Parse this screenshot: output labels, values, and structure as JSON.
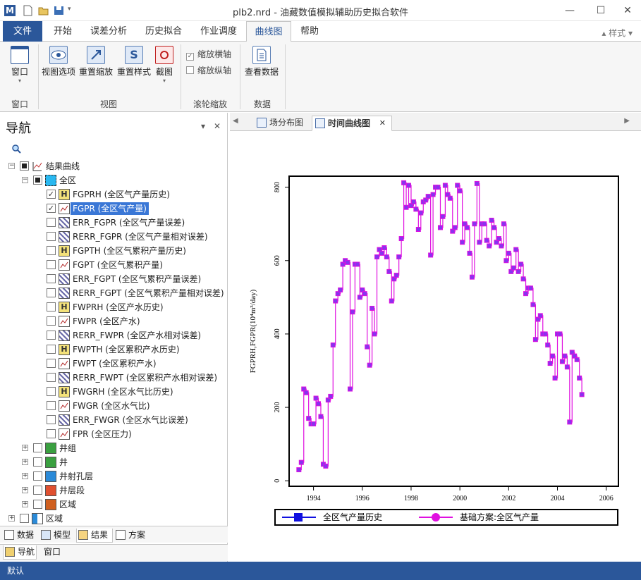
{
  "window": {
    "title": "plb2.nrd - 油藏数值模拟辅助历史拟合软件",
    "minimize": "—",
    "maximize": "☐",
    "close": "✕"
  },
  "tabs": [
    "文件",
    "开始",
    "误差分析",
    "历史拟合",
    "作业调度",
    "曲线图",
    "帮助"
  ],
  "style_menu": "▴ 样式 ▾",
  "ribbon": {
    "window_btn": "窗口",
    "view_options": "视图选项",
    "reset_zoom": "重置缩放",
    "reset_style": "重置样式",
    "screenshot": "截图",
    "zoom_x": "缩放横轴",
    "zoom_y": "缩放纵轴",
    "view_data": "查看数据",
    "group_window": "窗口",
    "group_view": "视图",
    "group_wheel": "滚轮缩放",
    "group_data": "数据"
  },
  "nav": {
    "title": "导航",
    "pin": "▾",
    "close": "✕",
    "tree": {
      "root": "结果曲线",
      "region_all": "全区",
      "items": [
        {
          "label": "FGPRH (全区气产量历史)",
          "checked": "✓"
        },
        {
          "label": "FGPR (全区气产量)",
          "checked": "✓"
        },
        {
          "label": "ERR_FGPR (全区气产量误差)",
          "checked": ""
        },
        {
          "label": "RERR_FGPR (全区气产量相对误差)",
          "checked": ""
        },
        {
          "label": "FGPTH (全区气累积产量历史)",
          "checked": ""
        },
        {
          "label": "FGPT (全区气累积产量)",
          "checked": ""
        },
        {
          "label": "ERR_FGPT (全区气累积产量误差)",
          "checked": ""
        },
        {
          "label": "RERR_FGPT (全区气累积产量相对误差)",
          "checked": ""
        },
        {
          "label": "FWPRH (全区产水历史)",
          "checked": ""
        },
        {
          "label": "FWPR (全区产水)",
          "checked": ""
        },
        {
          "label": "RERR_FWPR (全区产水相对误差)",
          "checked": ""
        },
        {
          "label": "FWPTH (全区累积产水历史)",
          "checked": ""
        },
        {
          "label": "FWPT (全区累积产水)",
          "checked": ""
        },
        {
          "label": "RERR_FWPT (全区累积产水相对误差)",
          "checked": ""
        },
        {
          "label": "FWGRH (全区水气比历史)",
          "checked": ""
        },
        {
          "label": "FWGR (全区水气比)",
          "checked": ""
        },
        {
          "label": "ERR_FWGR (全区水气比误差)",
          "checked": ""
        },
        {
          "label": "FPR (全区压力)",
          "checked": ""
        }
      ],
      "groups": [
        "井组",
        "井",
        "井射孔层",
        "井层段",
        "区域"
      ],
      "region": "区域"
    },
    "tabs": [
      "数据",
      "模型",
      "结果",
      "方案"
    ],
    "bottom_tabs": [
      "导航",
      "窗口"
    ]
  },
  "doc": {
    "tab1": "场分布图",
    "tab2": "时间曲线图",
    "tab_close": "✕"
  },
  "status": "默认",
  "colors": {
    "accent": "#2b579a",
    "series_history": "#1010e0",
    "series_base": "#e010e0"
  },
  "chart_data": {
    "type": "line",
    "ylabel": "FGPRH,FGPR(10⁴m³/day)",
    "xlabel": "",
    "xlim": [
      1993.0,
      2006.5
    ],
    "ylim": [
      -15,
      830
    ],
    "xticks": [
      "1994",
      "1996",
      "1998",
      "2000",
      "2002",
      "2004",
      "2006"
    ],
    "yticks": [
      "0",
      "200",
      "400",
      "600",
      "800"
    ],
    "series": [
      {
        "name": "全区气产量历史",
        "color": "#1010e0"
      },
      {
        "name": "基础方案:全区气产量",
        "color": "#e010e0"
      }
    ],
    "x": [
      1993.4,
      1993.5,
      1993.6,
      1993.7,
      1993.8,
      1993.9,
      1994.0,
      1994.1,
      1994.2,
      1994.3,
      1994.4,
      1994.5,
      1994.6,
      1994.7,
      1994.8,
      1994.9,
      1995.0,
      1995.1,
      1995.2,
      1995.3,
      1995.4,
      1995.5,
      1995.6,
      1995.7,
      1995.8,
      1995.9,
      1996.0,
      1996.1,
      1996.2,
      1996.3,
      1996.4,
      1996.5,
      1996.6,
      1996.7,
      1996.8,
      1996.9,
      1997.0,
      1997.1,
      1997.2,
      1997.3,
      1997.4,
      1997.5,
      1997.6,
      1997.7,
      1997.8,
      1997.9,
      1998.0,
      1998.1,
      1998.2,
      1998.3,
      1998.4,
      1998.5,
      1998.6,
      1998.7,
      1998.8,
      1998.9,
      1999.0,
      1999.1,
      1999.2,
      1999.3,
      1999.4,
      1999.5,
      1999.6,
      1999.7,
      1999.8,
      1999.9,
      2000.0,
      2000.1,
      2000.2,
      2000.3,
      2000.4,
      2000.5,
      2000.6,
      2000.7,
      2000.8,
      2000.9,
      2001.0,
      2001.1,
      2001.2,
      2001.3,
      2001.4,
      2001.5,
      2001.6,
      2001.7,
      2001.8,
      2001.9,
      2002.0,
      2002.1,
      2002.2,
      2002.3,
      2002.4,
      2002.5,
      2002.6,
      2002.7,
      2002.8,
      2002.9,
      2003.0,
      2003.1,
      2003.2,
      2003.3,
      2003.4,
      2003.5,
      2003.6,
      2003.7,
      2003.8,
      2003.9,
      2004.0,
      2004.1,
      2004.2,
      2004.3,
      2004.4,
      2004.5,
      2004.6,
      2004.7,
      2004.8,
      2004.9,
      2005.0
    ],
    "values": [
      30,
      50,
      250,
      240,
      170,
      155,
      155,
      225,
      210,
      175,
      45,
      40,
      220,
      230,
      370,
      490,
      510,
      520,
      590,
      600,
      595,
      250,
      460,
      590,
      590,
      500,
      520,
      510,
      365,
      315,
      470,
      400,
      610,
      630,
      620,
      635,
      610,
      570,
      490,
      550,
      560,
      610,
      660,
      812,
      745,
      805,
      750,
      760,
      740,
      685,
      730,
      760,
      765,
      775,
      615,
      780,
      800,
      800,
      690,
      720,
      805,
      780,
      770,
      680,
      690,
      805,
      790,
      650,
      700,
      690,
      620,
      555,
      700,
      810,
      650,
      700,
      700,
      655,
      640,
      710,
      690,
      650,
      660,
      640,
      700,
      600,
      620,
      570,
      580,
      630,
      570,
      590,
      550,
      510,
      525,
      525,
      480,
      385,
      440,
      450,
      400,
      400,
      370,
      320,
      340,
      280,
      400,
      400,
      325,
      340,
      310,
      160,
      350,
      340,
      330,
      280,
      235
    ]
  }
}
